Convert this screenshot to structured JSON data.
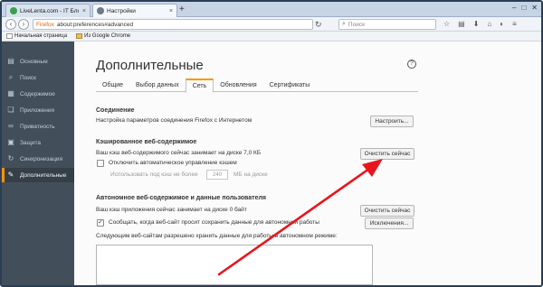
{
  "browser": {
    "tabs": [
      {
        "label": "LiveLenta.com - IT Блог о...",
        "active": false,
        "color": "#3aa24a"
      },
      {
        "label": "Настройки",
        "active": true,
        "color": "#6a7b8c"
      }
    ],
    "url_brand": "Firefox",
    "url": "about:preferences#advanced",
    "search_placeholder": "Поиск",
    "bookmarks": [
      {
        "label": "Начальная страница",
        "icon": "folder-icon"
      },
      {
        "label": "Из Google Chrome",
        "icon": "folder-icon"
      }
    ]
  },
  "sidebar": {
    "items": [
      {
        "label": "Основные",
        "icon": "general-icon",
        "glyph": "▤",
        "active": false
      },
      {
        "label": "Поиск",
        "icon": "search-icon",
        "glyph": "⌕",
        "active": false
      },
      {
        "label": "Содержимое",
        "icon": "content-icon",
        "glyph": "▦",
        "active": false
      },
      {
        "label": "Приложения",
        "icon": "applications-icon",
        "glyph": "❏",
        "active": false
      },
      {
        "label": "Приватность",
        "icon": "privacy-mask-icon",
        "glyph": "∞",
        "active": false
      },
      {
        "label": "Защита",
        "icon": "lock-icon",
        "glyph": "▣",
        "active": false
      },
      {
        "label": "Синхронизация",
        "icon": "sync-icon",
        "glyph": "↻",
        "active": false
      },
      {
        "label": "Дополнительные",
        "icon": "advanced-icon",
        "glyph": "✎",
        "active": true
      }
    ]
  },
  "main": {
    "title": "Дополнительные",
    "tabs": [
      "Общие",
      "Выбор данных",
      "Сеть",
      "Обновления",
      "Сертификаты"
    ],
    "active_tab": "Сеть",
    "connection": {
      "heading": "Соединение",
      "desc": "Настройка параметров соединения Firefox с Интернетом",
      "button": "Настроить..."
    },
    "cache": {
      "heading": "Кэшированное веб-содержимое",
      "desc": "Ваш кэш веб-содержимого сейчас занимает на диске 7,0 КБ",
      "button": "Очистить сейчас",
      "override_label": "Отключить автоматическое управление кэшем",
      "override_checked": false,
      "limit_label": "Использовать под кэш не более",
      "limit_value": "240",
      "limit_unit": "МБ на диске"
    },
    "offline": {
      "heading": "Автономное веб-содержимое и данные пользователя",
      "desc": "Ваш кэш приложения сейчас занимает на диске 0 байт",
      "button": "Очистить сейчас",
      "notify_label": "Сообщать, когда веб-сайт просит сохранить данные для автономной работы",
      "notify_checked": true,
      "exceptions_button": "Исключения...",
      "allowed_label": "Следующим веб-сайтам разрешено хранить данные для работы в автономном режиме:"
    }
  },
  "colors": {
    "accent": "#ff9500",
    "arrow": "#e8161c",
    "sidebar": "#424f5a"
  }
}
